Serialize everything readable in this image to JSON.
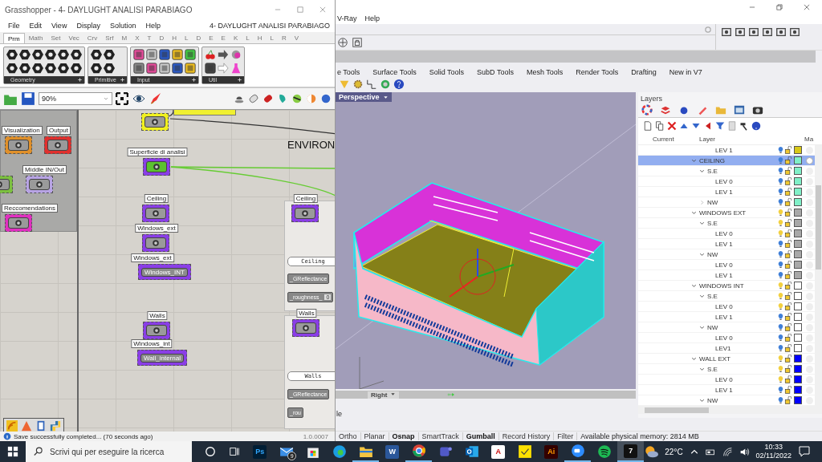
{
  "grasshopper": {
    "title": "Grasshopper - 4- DAYLUGHT ANALISI PARABIAGO",
    "menu": [
      "File",
      "Edit",
      "View",
      "Display",
      "Solution",
      "Help"
    ],
    "document_name": "4- DAYLUGHT ANALISI PARABIAGO",
    "tabs": [
      {
        "label": "Prm",
        "selected": true
      },
      {
        "label": "Math",
        "selected": false
      },
      {
        "label": "Set",
        "selected": false
      },
      {
        "label": "Vec",
        "selected": false
      },
      {
        "label": "Crv",
        "selected": false
      },
      {
        "label": "Srf",
        "selected": false
      },
      {
        "label": "M",
        "selected": false
      },
      {
        "label": "X",
        "selected": false
      },
      {
        "label": "T",
        "selected": false
      },
      {
        "label": "D",
        "selected": false
      },
      {
        "label": "H",
        "selected": false
      },
      {
        "label": "L",
        "selected": false
      },
      {
        "label": "D",
        "selected": false
      },
      {
        "label": "E",
        "selected": false
      },
      {
        "label": "E",
        "selected": false
      },
      {
        "label": "K",
        "selected": false
      },
      {
        "label": "L",
        "selected": false
      },
      {
        "label": "H",
        "selected": false
      },
      {
        "label": "L",
        "selected": false
      },
      {
        "label": "R",
        "selected": false
      },
      {
        "label": "V",
        "selected": false
      }
    ],
    "ribbon_groups": [
      "Geometry",
      "Primitive",
      "Input",
      "Util"
    ],
    "zoom": "90%",
    "canvas": {
      "heading": "ENVIRON",
      "nodes": [
        {
          "kind": "param",
          "label": "Visualization",
          "color": "#e0902a"
        },
        {
          "kind": "param",
          "label": "Output",
          "color": "#e0302e"
        },
        {
          "kind": "param",
          "color": "#7cc040"
        },
        {
          "kind": "param",
          "label": "Middle IN/Out",
          "color": "#b8a4e4"
        },
        {
          "kind": "param",
          "label": "Reccomendations",
          "color": "#e030c0"
        },
        {
          "kind": "param",
          "color": "#f0f020"
        },
        {
          "kind": "data_param",
          "label": "Superficie di analisi",
          "color": "#8a3ee6"
        },
        {
          "kind": "param",
          "label": "Ceiling",
          "color": "#8a3ee6"
        },
        {
          "kind": "param",
          "label": "Windows_ext",
          "color": "#8a3ee6"
        },
        {
          "kind": "text_param",
          "label": "Windows_ext",
          "text": "Windows_INT",
          "color": "#8a3ee6"
        },
        {
          "kind": "param",
          "label": "Walls",
          "color": "#8a3ee6"
        },
        {
          "kind": "text_param",
          "label": "Windows_int",
          "text": "Wall_internal",
          "color": "#8a3ee6"
        },
        {
          "kind": "param",
          "label": "Ceiling",
          "color": "#8a3ee6"
        },
        {
          "kind": "panel",
          "text": "Ceiling"
        },
        {
          "kind": "input",
          "text": "_GReflectance"
        },
        {
          "kind": "input",
          "text": "_roughness_",
          "value": "0"
        },
        {
          "kind": "param",
          "label": "Walls",
          "color": "#8a3ee6"
        },
        {
          "kind": "panel",
          "text": "Walls"
        },
        {
          "kind": "input",
          "text": "_GReflectance"
        },
        {
          "kind": "input",
          "text": "_rou"
        }
      ]
    },
    "status": "Save successfully completed... (70 seconds ago)",
    "version": "1.0.0007"
  },
  "rhino": {
    "menu": [
      "V-Ray",
      "Help"
    ],
    "tabs": [
      "e Tools",
      "Surface Tools",
      "Solid Tools",
      "SubD Tools",
      "Mesh Tools",
      "Render Tools",
      "Drafting",
      "New in V7"
    ],
    "viewport": {
      "title": "Perspective",
      "bottom_tab": "Right"
    },
    "command_prompt": "le",
    "layers": {
      "title": "Layers",
      "columns": [
        "Current",
        "Layer",
        "Ma"
      ],
      "tree": [
        {
          "children": [
            {
              "children": [
                {
                  "name": "LEV 1",
                  "selected": false,
                  "bulb_on": false,
                  "color": "#d8c818"
                }
              ]
            }
          ]
        },
        {
          "name": "CEILING",
          "expanded": true,
          "selected": true,
          "bulb_on": false,
          "color": "#80f0c8",
          "children": [
            {
              "name": "S.E",
              "expanded": true,
              "selected": false,
              "bulb_on": false,
              "color": "#80f0c8",
              "children": [
                {
                  "name": "LEV 0",
                  "selected": false,
                  "bulb_on": false,
                  "color": "#80f0c8"
                },
                {
                  "name": "LEV 1",
                  "selected": false,
                  "bulb_on": false,
                  "color": "#80f0c8"
                }
              ]
            },
            {
              "name": "NW",
              "expanded": false,
              "selected": false,
              "bulb_on": false,
              "color": "#80f0c8"
            }
          ]
        },
        {
          "name": "WINDOWS EXT",
          "expanded": true,
          "selected": false,
          "bulb_on": true,
          "color": "#a8a8a8",
          "children": [
            {
              "name": "S.E",
              "expanded": true,
              "selected": false,
              "bulb_on": true,
              "color": "#a8a8a8",
              "children": [
                {
                  "name": "LEV 0",
                  "selected": false,
                  "bulb_on": true,
                  "color": "#a8a8a8"
                },
                {
                  "name": "LEV 1",
                  "selected": false,
                  "bulb_on": false,
                  "color": "#a8a8a8"
                }
              ]
            },
            {
              "name": "NW",
              "expanded": true,
              "selected": false,
              "bulb_on": false,
              "color": "#a8a8a8",
              "children": [
                {
                  "name": "LEV 0",
                  "selected": false,
                  "bulb_on": false,
                  "color": "#a8a8a8"
                },
                {
                  "name": "LEV 1",
                  "selected": false,
                  "bulb_on": false,
                  "color": "#a8a8a8"
                }
              ]
            }
          ]
        },
        {
          "name": "WINDOWS INT",
          "expanded": true,
          "selected": false,
          "bulb_on": true,
          "color": "#ffffff",
          "children": [
            {
              "name": "S.E",
              "expanded": true,
              "selected": false,
              "bulb_on": true,
              "color": "#ffffff",
              "children": [
                {
                  "name": "LEV 0",
                  "selected": false,
                  "bulb_on": true,
                  "color": "#ffffff"
                },
                {
                  "name": "LEV 1",
                  "selected": false,
                  "bulb_on": false,
                  "color": "#ffffff"
                }
              ]
            },
            {
              "name": "NW",
              "expanded": true,
              "selected": false,
              "bulb_on": false,
              "color": "#ffffff",
              "children": [
                {
                  "name": "LEV 0",
                  "selected": false,
                  "bulb_on": false,
                  "color": "#ffffff"
                },
                {
                  "name": "LEV1",
                  "selected": false,
                  "bulb_on": false,
                  "color": "#ffffff"
                }
              ]
            }
          ]
        },
        {
          "name": "WALL EXT",
          "expanded": true,
          "selected": false,
          "bulb_on": true,
          "color": "#0000ff",
          "children": [
            {
              "name": "S.E",
              "expanded": true,
              "selected": false,
              "bulb_on": true,
              "color": "#0000ff",
              "children": [
                {
                  "name": "LEV 0",
                  "selected": false,
                  "bulb_on": true,
                  "color": "#0000ff"
                },
                {
                  "name": "LEV 1",
                  "selected": false,
                  "bulb_on": false,
                  "color": "#0000ff"
                }
              ]
            },
            {
              "name": "NW",
              "expanded": true,
              "selected": false,
              "bulb_on": false,
              "color": "#0000ff"
            }
          ]
        }
      ]
    },
    "status_panes": [
      {
        "label": "Ortho",
        "on": false
      },
      {
        "label": "Planar",
        "on": false
      },
      {
        "label": "Osnap",
        "on": true
      },
      {
        "label": "SmartTrack",
        "on": false
      },
      {
        "label": "Gumball",
        "on": true
      },
      {
        "label": "Record History",
        "on": false
      },
      {
        "label": "Filter",
        "on": false
      }
    ],
    "memory": "Available physical memory: 2814 MB"
  },
  "taskbar": {
    "search_placeholder": "Scrivi qui per eseguire la ricerca",
    "apps": [
      {
        "kind": "photoshop",
        "glyph": "Ps",
        "running": false,
        "selected": false
      },
      {
        "kind": "mail",
        "badge": "9",
        "running": false,
        "selected": false
      },
      {
        "kind": "store",
        "running": false,
        "selected": false
      },
      {
        "kind": "edge",
        "running": false,
        "selected": false
      },
      {
        "kind": "explorer",
        "running": true,
        "selected": false
      },
      {
        "kind": "word",
        "glyph": "W",
        "running": false,
        "selected": false
      },
      {
        "kind": "chrome",
        "running": true,
        "selected": false
      },
      {
        "kind": "teams",
        "running": false,
        "selected": false
      },
      {
        "kind": "outlook",
        "running": false,
        "selected": false
      },
      {
        "kind": "autocad",
        "glyph": "A",
        "running": false,
        "selected": false
      },
      {
        "kind": "notes",
        "running": false,
        "selected": false
      },
      {
        "kind": "illustrator",
        "glyph": "Ai",
        "running": false,
        "selected": false
      },
      {
        "kind": "zoom",
        "running": true,
        "selected": false
      },
      {
        "kind": "spotify",
        "running": false,
        "selected": false
      },
      {
        "kind": "rhino",
        "glyph": "7",
        "running": true,
        "selected": true
      }
    ],
    "temperature": "22°C",
    "time": "10:33",
    "date": "02/11/2022"
  }
}
